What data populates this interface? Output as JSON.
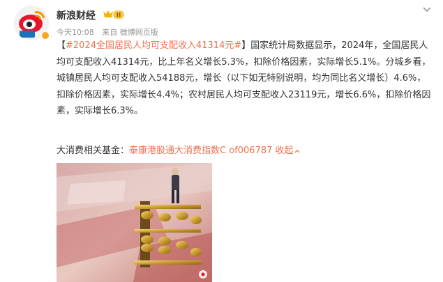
{
  "author": {
    "name": "新浪财经",
    "avatar_icon": "weibo-eye-logo",
    "verified_badge": "verified-icon",
    "vip_badge_icon": "vip-level-badge-icon"
  },
  "meta": {
    "time": "今天10:08",
    "source": "来自 微博网页版"
  },
  "post": {
    "topic": "#2024全国居民人均可支配收入41314元#",
    "text_1": "国家统计局数据显示，2024年，全国居民人均可支配收入41314元，比上年名义增长5.3%，扣除价格因素，实际增长5.1%。分城乡看，城镇居民人均可支配收入54188元，增长（以下如无特别说明，均为同比名义增长）4.6%，扣除价格因素，实际增长4.4%；农村居民人均可支配收入23119元，增长6.6%，扣除价格因素，实际增长6.3%。"
  },
  "fund": {
    "label": "大消费相关基金：",
    "link_text": "泰康港股通大消费指数C of006787",
    "collapse_text": "收起"
  },
  "image": {
    "watermark_icon": "weibo-watermark-icon"
  }
}
